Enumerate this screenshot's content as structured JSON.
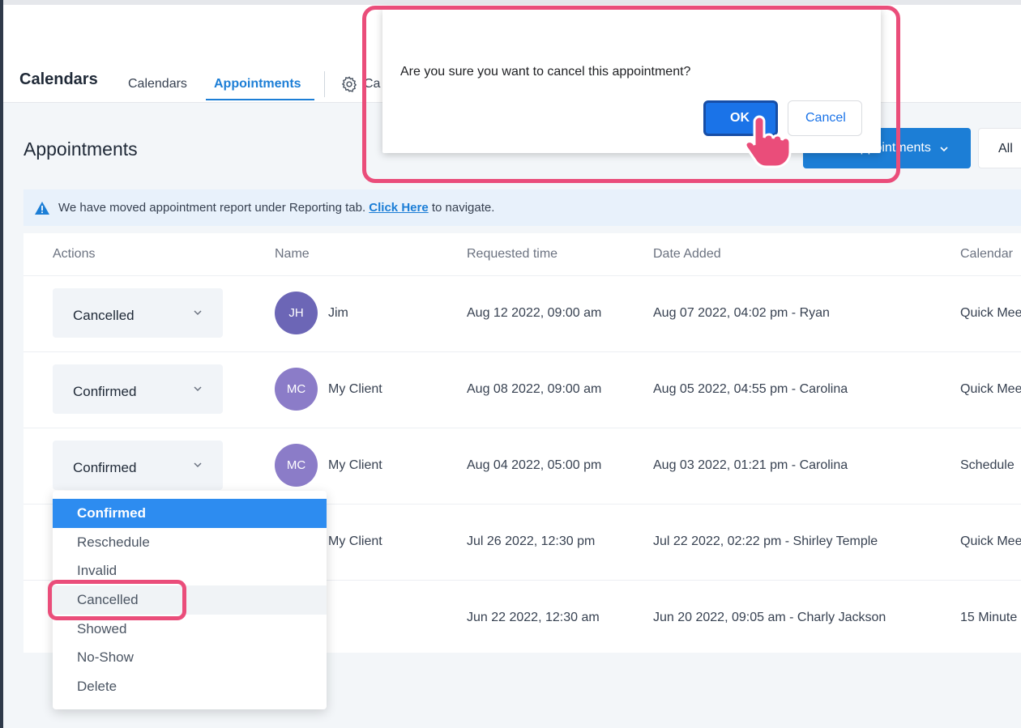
{
  "header": {
    "brand": "Calendars",
    "tabs": [
      {
        "label": "Calendars",
        "active": false
      },
      {
        "label": "Appointments",
        "active": true
      }
    ],
    "partial_tab_label": "Ca"
  },
  "page": {
    "title": "Appointments",
    "appointments_button_label": "Appointments",
    "filter_label": "All"
  },
  "notice": {
    "text_before": "We have moved appointment report under Reporting tab.",
    "link_text": "Click Here",
    "text_after": "to navigate."
  },
  "table": {
    "columns": [
      "Actions",
      "Name",
      "Requested time",
      "Date Added",
      "Calendar"
    ],
    "rows": [
      {
        "status": "Cancelled",
        "initials": "JH",
        "name": "Jim",
        "requested": "Aug 12 2022, 09:00 am",
        "added": "Aug 07 2022, 04:02 pm - Ryan",
        "calendar": "Quick Mee"
      },
      {
        "status": "Confirmed",
        "initials": "MC",
        "name": "My Client",
        "requested": "Aug 08 2022, 09:00 am",
        "added": "Aug 05 2022, 04:55 pm - Carolina",
        "calendar": "Quick Mee"
      },
      {
        "status": "Confirmed",
        "initials": "MC",
        "name": "My Client",
        "requested": "Aug 04 2022, 05:00 pm",
        "added": "Aug 03 2022, 01:21 pm - Carolina",
        "calendar": "Schedule"
      },
      {
        "status": "",
        "initials": "",
        "name": "My Client",
        "requested": "Jul 26 2022, 12:30 pm",
        "added": "Jul 22 2022, 02:22 pm - Shirley Temple",
        "calendar": "Quick Mee"
      },
      {
        "status": "",
        "initials": "",
        "name": "",
        "requested": "Jun 22 2022, 12:30 am",
        "added": "Jun 20 2022, 09:05 am - Charly Jackson",
        "calendar": "15 Minute"
      }
    ]
  },
  "status_dropdown": {
    "options": [
      "Confirmed",
      "Reschedule",
      "Invalid",
      "Cancelled",
      "Showed",
      "No-Show",
      "Delete"
    ],
    "selected": "Confirmed",
    "hovered": "Cancelled"
  },
  "confirm_dialog": {
    "message": "Are you sure you want to cancel this appointment?",
    "ok_label": "OK",
    "cancel_label": "Cancel"
  },
  "colors": {
    "accent": "#1c7ed6",
    "annotation": "#ea4d7a",
    "avatar": "#8b7cc8"
  },
  "icons": [
    "gear-icon",
    "chevron-down-icon",
    "warning-icon",
    "pointer-hand-icon"
  ]
}
